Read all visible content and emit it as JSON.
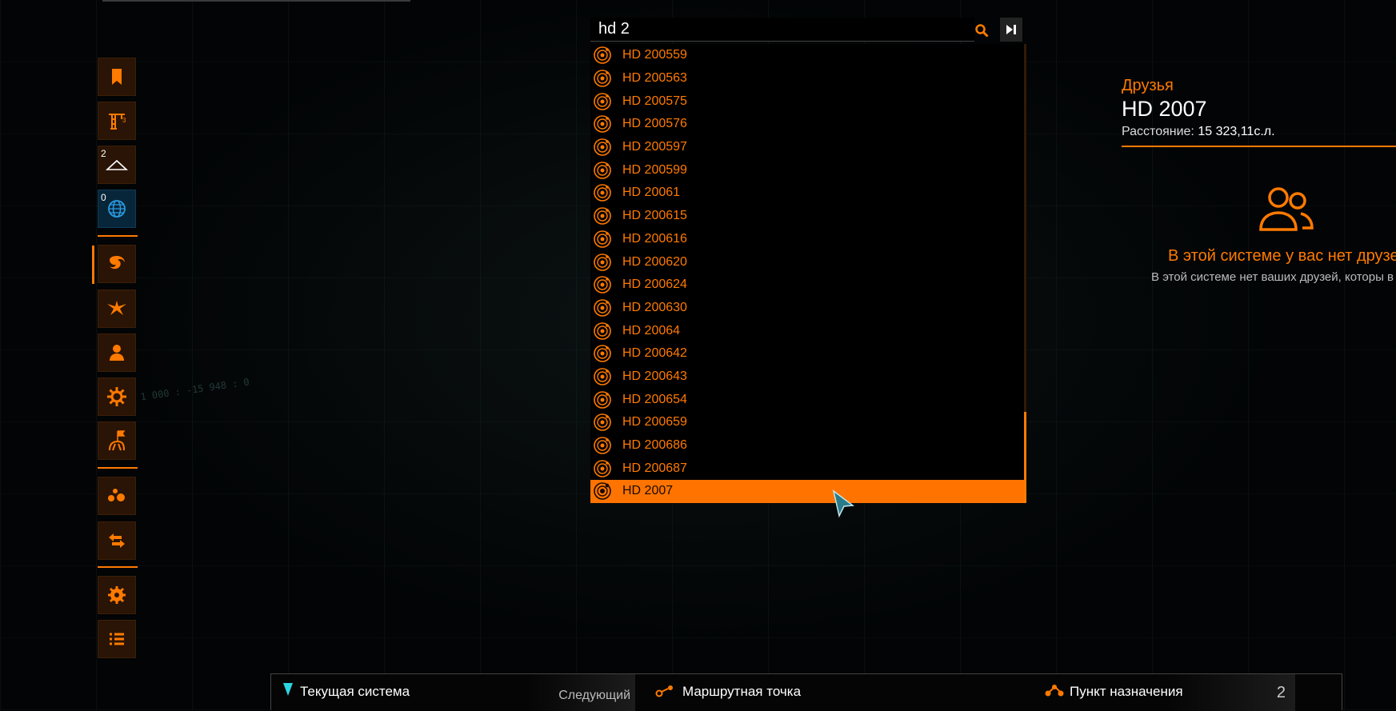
{
  "search": {
    "value": "hd 2",
    "search_icon": "search-icon",
    "skip_icon": "skip-to-end-icon"
  },
  "results": [
    "HD 200559",
    "HD 200563",
    "HD 200575",
    "HD 200576",
    "HD 200597",
    "HD 200599",
    "HD 20061",
    "HD 200615",
    "HD 200616",
    "HD 200620",
    "HD 200624",
    "HD 200630",
    "HD 20064",
    "HD 200642",
    "HD 200643",
    "HD 200654",
    "HD 200659",
    "HD 200686",
    "HD 200687",
    "HD 2007"
  ],
  "selected_result": "HD 2007",
  "sidebar": {
    "items": [
      {
        "icon": "bookmark-icon",
        "badge": ""
      },
      {
        "icon": "crane-icon",
        "badge": ""
      },
      {
        "icon": "dome-icon",
        "badge": "2"
      },
      {
        "icon": "globe-icon",
        "badge": "0"
      },
      {
        "icon": "galaxy-icon",
        "badge": ""
      },
      {
        "icon": "wings-icon",
        "badge": ""
      },
      {
        "icon": "person-icon",
        "badge": ""
      },
      {
        "icon": "cog-icon",
        "badge": ""
      },
      {
        "icon": "flag-station-icon",
        "badge": ""
      },
      {
        "icon": "dots-icon",
        "badge": ""
      },
      {
        "icon": "swap-arrows-icon",
        "badge": ""
      },
      {
        "icon": "settings-icon",
        "badge": ""
      },
      {
        "icon": "list-icon",
        "badge": ""
      }
    ]
  },
  "right_panel": {
    "section": "Друзья",
    "system_name": "HD 2007",
    "distance_label": "Расстояние:",
    "distance_value": "15 323,11с.л.",
    "empty_title": "В этой системе у вас нет друзе",
    "empty_text": "В этой системе нет ваших друзей, которы в сети."
  },
  "route_bar": {
    "current_system": "Текущая система",
    "next_label": "Следующий",
    "waypoint": "Маршрутная точка",
    "count": "2",
    "destination": "Пункт назначения"
  },
  "colors": {
    "accent": "#ff7a00",
    "selected_bg": "#ff7400",
    "background": "#020405",
    "blue_accent": "#2b9be0"
  }
}
